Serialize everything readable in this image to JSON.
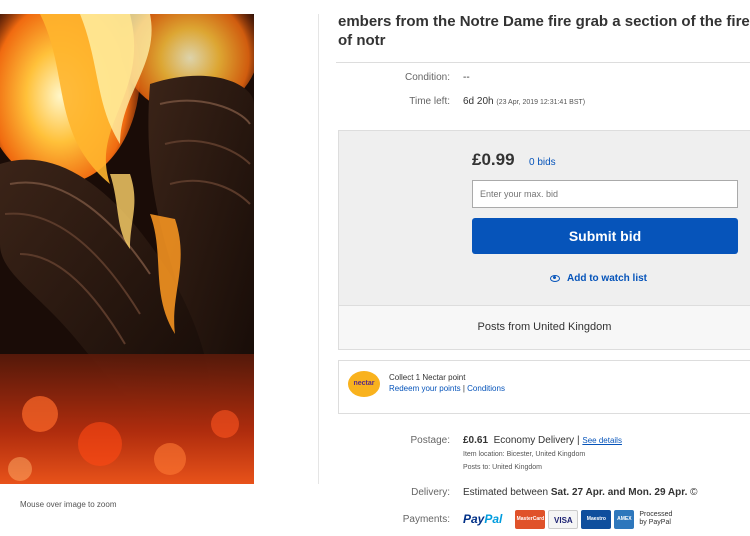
{
  "listing": {
    "title": "embers from  the  Notre Dame fire grab a section of the fire of notr",
    "zoom_hint": "Mouse over image to zoom"
  },
  "details": {
    "condition_label": "Condition:",
    "condition_value": "--",
    "time_left_label": "Time left:",
    "time_left_value": "6d 20h",
    "time_left_detail": "(23 Apr, 2019   12:31:41 BST)"
  },
  "bid": {
    "price": "£0.99",
    "bids_count": "0 bids",
    "input_placeholder": "Enter your max. bid",
    "submit_label": "Submit bid",
    "watch_label": "Add to watch list",
    "posts_from": "Posts from United Kingdom"
  },
  "nectar": {
    "logo_text": "nectar",
    "line1": "Collect 1 Nectar point",
    "redeem_link": "Redeem your points",
    "separator": "|",
    "conditions_link": "Conditions"
  },
  "shipping": {
    "postage_label": "Postage:",
    "postage_price": "£0.61",
    "postage_service": "Economy Delivery",
    "postage_separator": "|",
    "see_details": "See details",
    "item_location": "Item location:  Bicester, United Kingdom",
    "posts_to": "Posts to:  United Kingdom",
    "delivery_label": "Delivery:",
    "delivery_prefix": "Estimated between",
    "delivery_dates": "Sat. 27 Apr. and Mon. 29 Apr.",
    "delivery_suffix": "©"
  },
  "payments": {
    "label": "Payments:",
    "paypal_pay": "Pay",
    "paypal_pal": "Pal",
    "card_mastercard": "MasterCard",
    "card_visa": "VISA",
    "card_maestro": "Maestro",
    "card_amex": "AMEX",
    "processed_line1": "Processed",
    "processed_line2": "by PayPal"
  },
  "colors": {
    "accent": "#0654ba",
    "bid_box_bg": "#efefef",
    "nectar_yellow": "#f9b21d"
  }
}
